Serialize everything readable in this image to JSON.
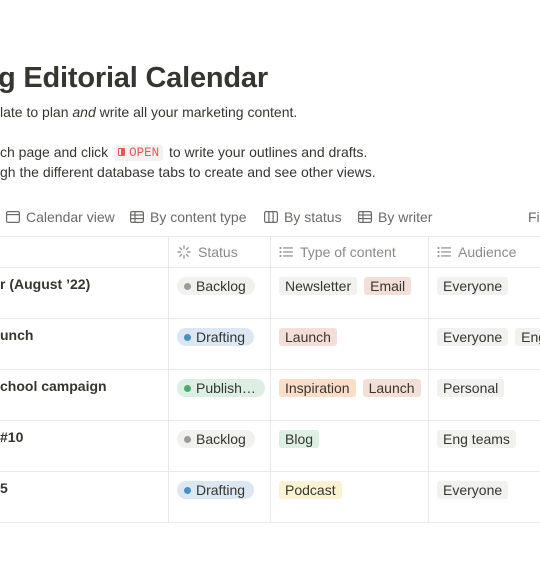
{
  "page": {
    "title": "g Editorial Calendar",
    "intro_line1_a": "late to plan ",
    "intro_line1_em": "and",
    "intro_line1_b": " write all your marketing content.",
    "intro_line2_a": "ch page and click ",
    "intro_line2_code": "OPEN",
    "intro_line2_b": " to write your outlines and drafts.",
    "intro_line3": "gh the different database tabs to create and see other views."
  },
  "tabs": [
    {
      "label": "Calendar view",
      "icon": "calendar-icon"
    },
    {
      "label": "By content type",
      "icon": "table-icon"
    },
    {
      "label": "By status",
      "icon": "board-icon"
    },
    {
      "label": "By writer",
      "icon": "table-icon"
    },
    {
      "label": "Fi",
      "icon": ""
    }
  ],
  "columns": [
    {
      "label": "",
      "icon": ""
    },
    {
      "label": "Status",
      "icon": "status-spinner-icon"
    },
    {
      "label": "Type of content",
      "icon": "list-icon"
    },
    {
      "label": "Audience",
      "icon": "list-icon"
    }
  ],
  "rows": [
    {
      "name": "r (August ’22)",
      "status": "Backlog",
      "status_color": "#9b9a97",
      "status_bg": "#f1f1ef",
      "types": [
        {
          "label": "Newsletter",
          "bg": "#f1f1ef"
        },
        {
          "label": "Email",
          "bg": "#f4dfd8"
        }
      ],
      "audience": [
        {
          "label": "Everyone",
          "bg": "#f1f1ef"
        }
      ]
    },
    {
      "name": "unch",
      "status": "Drafting",
      "status_color": "#4a90c2",
      "status_bg": "#dbe8f3",
      "types": [
        {
          "label": "Launch",
          "bg": "#f4dfd8"
        }
      ],
      "audience": [
        {
          "label": "Everyone",
          "bg": "#f1f1ef"
        },
        {
          "label": "Eng",
          "bg": "#f1f1ef"
        }
      ]
    },
    {
      "name": "chool campaign",
      "status": "Published",
      "status_color": "#4dab6f",
      "status_bg": "#dcefe2",
      "types": [
        {
          "label": "Inspiration",
          "bg": "#fadec9"
        },
        {
          "label": "Launch",
          "bg": "#f4dfd8"
        }
      ],
      "audience": [
        {
          "label": "Personal",
          "bg": "#f1f1ef"
        }
      ]
    },
    {
      "name": "#10",
      "status": "Backlog",
      "status_color": "#9b9a97",
      "status_bg": "#f1f1ef",
      "types": [
        {
          "label": "Blog",
          "bg": "#dcefe2"
        }
      ],
      "audience": [
        {
          "label": "Eng teams",
          "bg": "#f1f1ef"
        }
      ]
    },
    {
      "name": "5",
      "status": "Drafting",
      "status_color": "#4a90c2",
      "status_bg": "#dbe8f3",
      "types": [
        {
          "label": "Podcast",
          "bg": "#fbf1d3"
        }
      ],
      "audience": [
        {
          "label": "Everyone",
          "bg": "#f1f1ef"
        }
      ]
    }
  ]
}
